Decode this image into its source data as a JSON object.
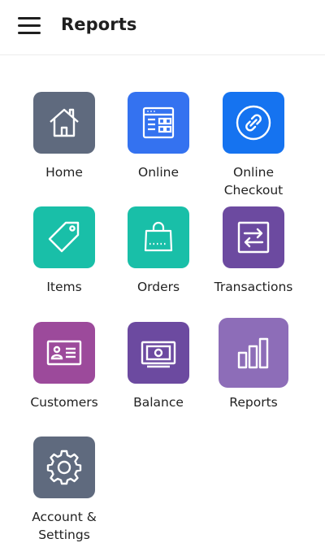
{
  "header": {
    "title": "Reports"
  },
  "tiles": [
    {
      "label": "Home",
      "icon": "house-icon",
      "color": "#5f6a7e"
    },
    {
      "label": "Online",
      "icon": "online-store-icon",
      "color": "#3472f0"
    },
    {
      "label": "Online\nCheckout",
      "icon": "link-icon",
      "color": "#1573f0"
    },
    {
      "label": "Items",
      "icon": "tag-icon",
      "color": "#19bfa8"
    },
    {
      "label": "Orders",
      "icon": "shopping-bag-icon",
      "color": "#19bfa8"
    },
    {
      "label": "Transactions",
      "icon": "transfer-arrows-icon",
      "color": "#6c4aa0"
    },
    {
      "label": "Customers",
      "icon": "id-card-icon",
      "color": "#9c4a9b"
    },
    {
      "label": "Balance",
      "icon": "banknote-icon",
      "color": "#6c4aa0"
    },
    {
      "label": "Reports",
      "icon": "bar-chart-icon",
      "color": "#8d6db8"
    },
    {
      "label": "Account &\nSettings",
      "icon": "gear-icon",
      "color": "#5f6a7e"
    }
  ]
}
